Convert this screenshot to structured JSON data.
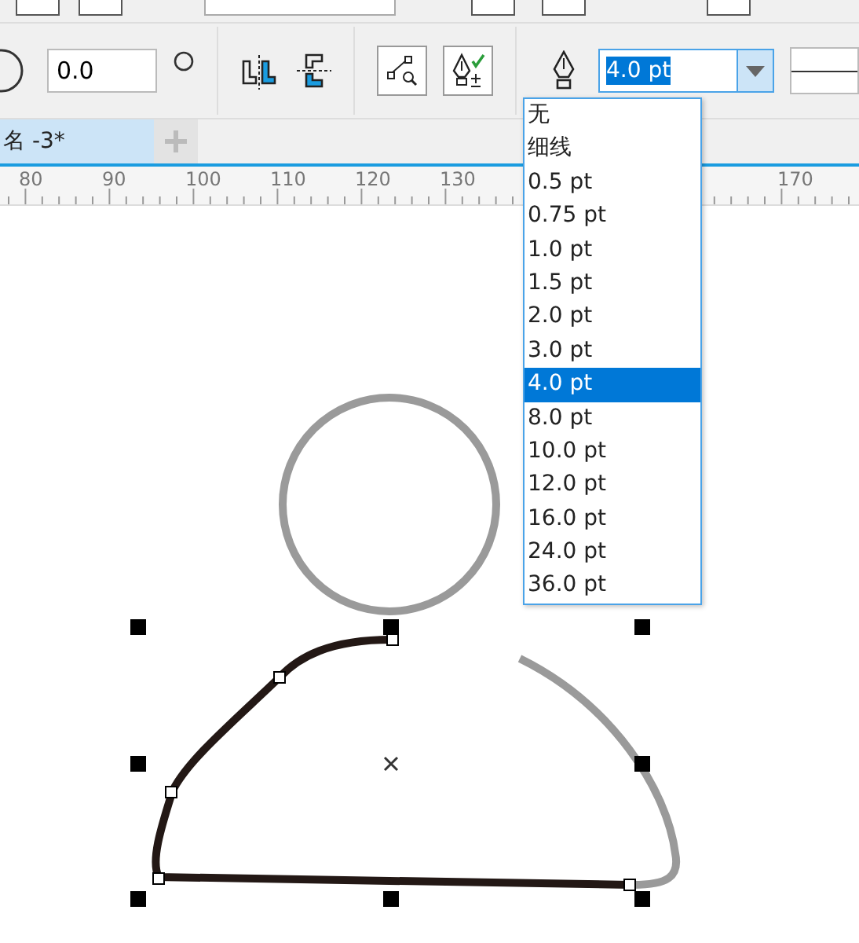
{
  "property_bar": {
    "corner_radius": "0.0",
    "outline_width": {
      "value": "4.0 pt",
      "expanded": true,
      "options": [
        {
          "label": "无",
          "selected": false
        },
        {
          "label": "细线",
          "selected": false
        },
        {
          "label": "0.5 pt",
          "selected": false
        },
        {
          "label": "0.75 pt",
          "selected": false
        },
        {
          "label": "1.0 pt",
          "selected": false
        },
        {
          "label": "1.5 pt",
          "selected": false
        },
        {
          "label": "2.0 pt",
          "selected": false
        },
        {
          "label": "3.0 pt",
          "selected": false
        },
        {
          "label": "4.0 pt",
          "selected": true
        },
        {
          "label": "8.0 pt",
          "selected": false
        },
        {
          "label": "10.0 pt",
          "selected": false
        },
        {
          "label": "12.0 pt",
          "selected": false
        },
        {
          "label": "16.0 pt",
          "selected": false
        },
        {
          "label": "24.0 pt",
          "selected": false
        },
        {
          "label": "36.0 pt",
          "selected": false
        }
      ]
    }
  },
  "document_tabs": [
    {
      "label": "名 -3*",
      "selected": true
    }
  ],
  "ruler": {
    "labels": [
      "80",
      "90",
      "100",
      "110",
      "120",
      "130",
      "170"
    ]
  }
}
